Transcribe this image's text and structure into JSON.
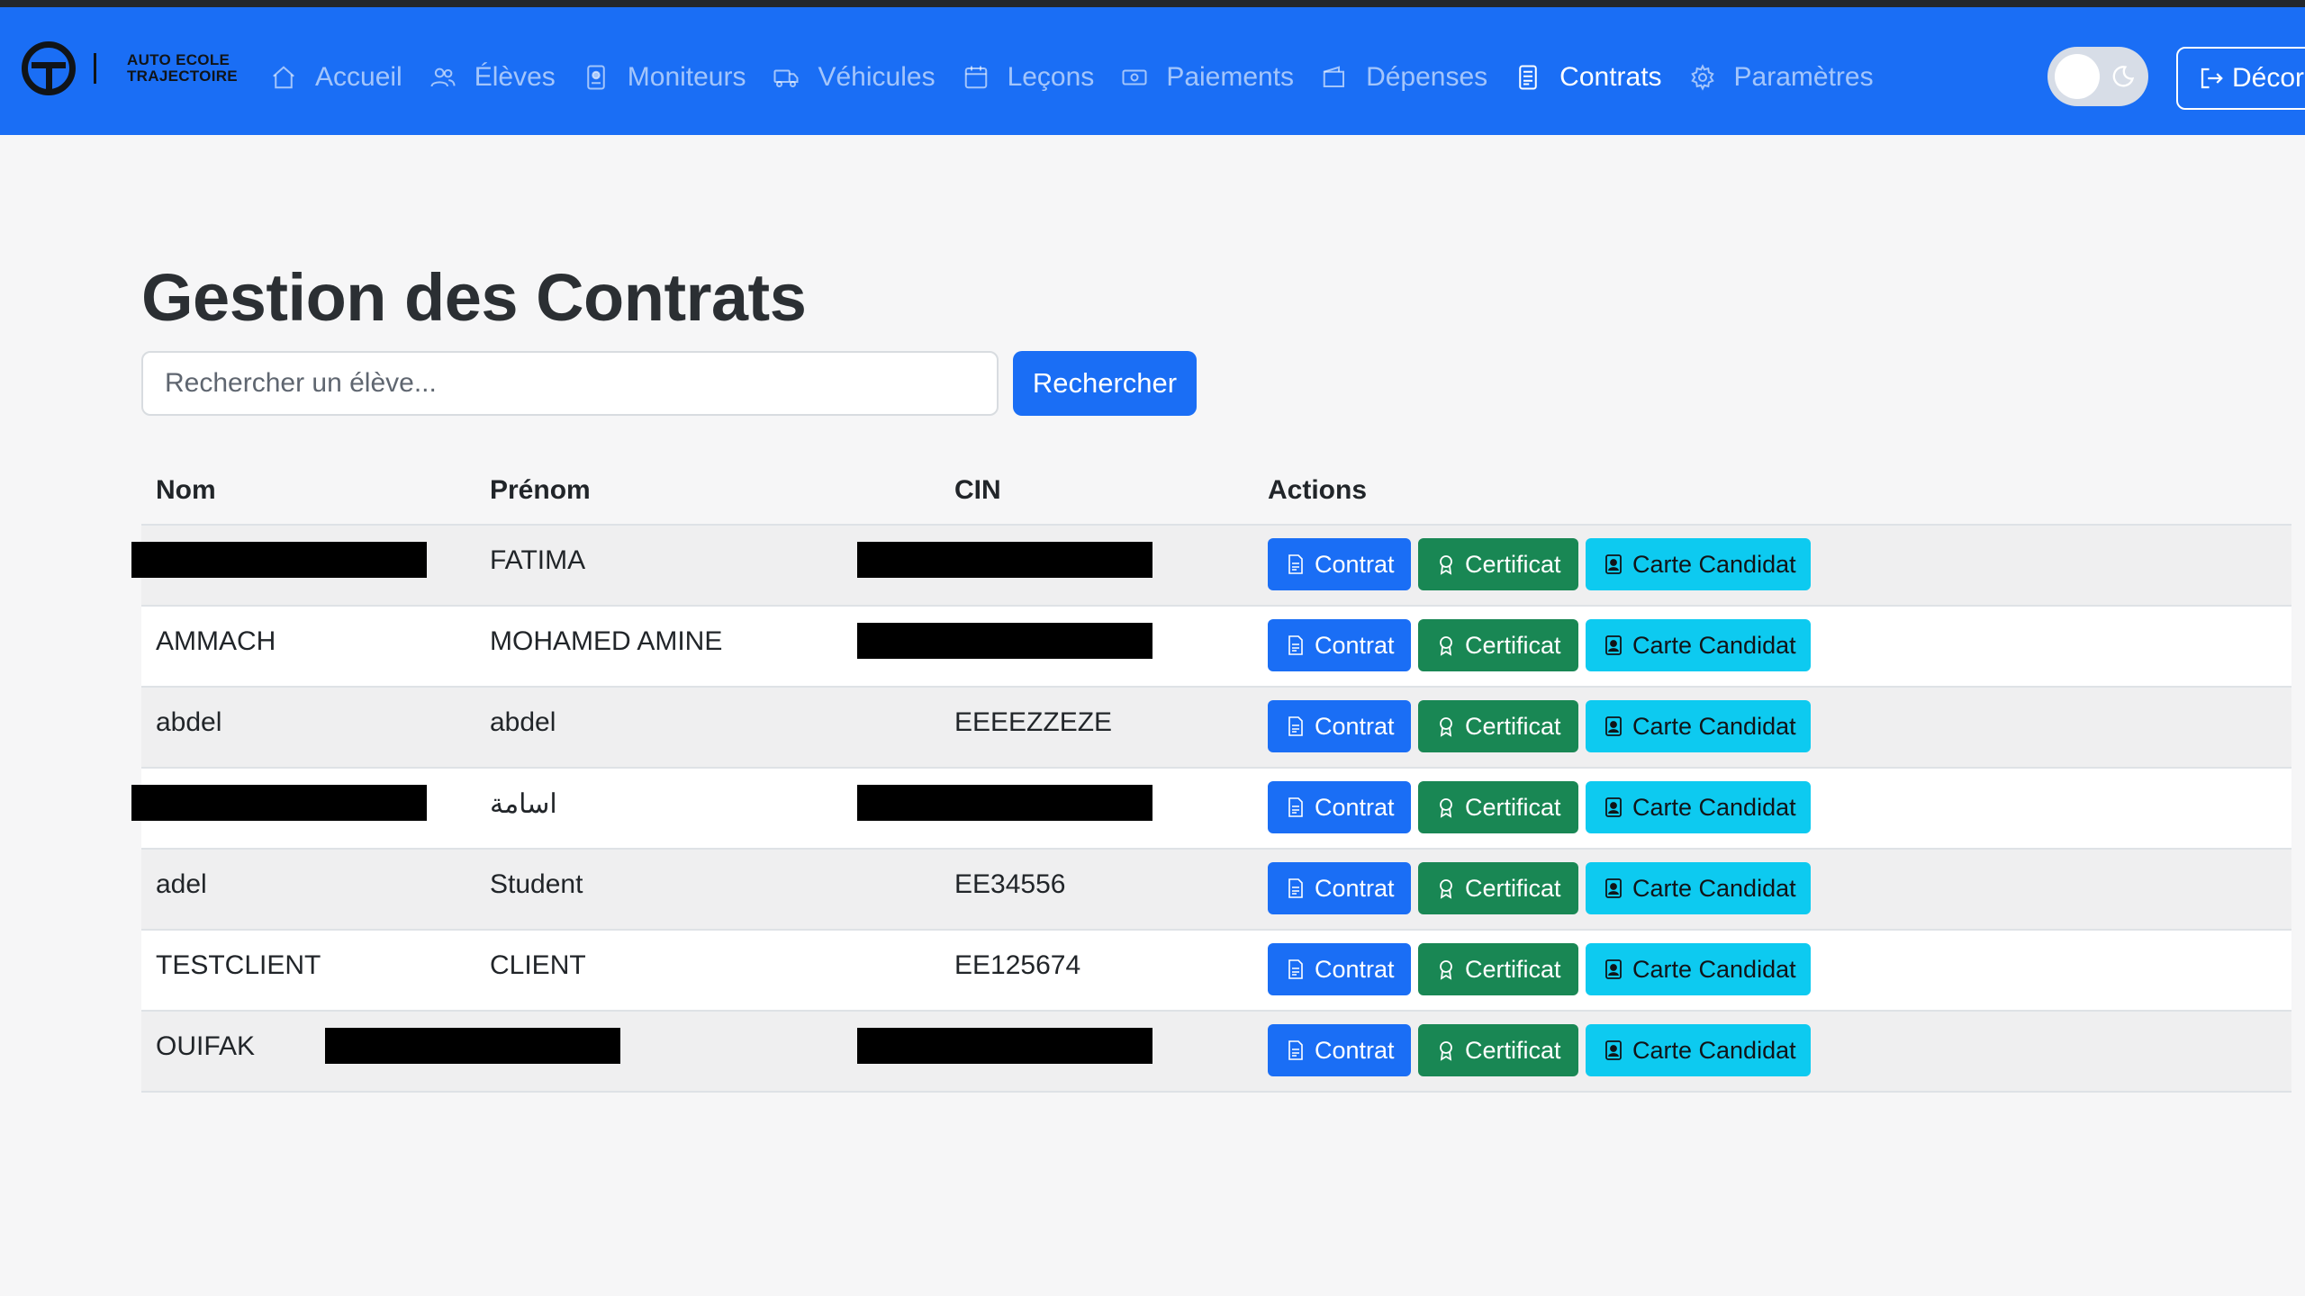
{
  "brand": {
    "line1": "AUTO ECOLE",
    "line2": "TRAJECTOIRE"
  },
  "nav": {
    "items": [
      {
        "label": "Accueil",
        "icon": "home-icon"
      },
      {
        "label": "Élèves",
        "icon": "users-icon"
      },
      {
        "label": "Moniteurs",
        "icon": "badge-icon"
      },
      {
        "label": "Véhicules",
        "icon": "truck-icon"
      },
      {
        "label": "Leçons",
        "icon": "calendar-icon"
      },
      {
        "label": "Paiements",
        "icon": "cash-icon"
      },
      {
        "label": "Dépenses",
        "icon": "wallet-icon"
      },
      {
        "label": "Contrats",
        "icon": "document-icon",
        "active": true
      },
      {
        "label": "Paramètres",
        "icon": "gear-icon"
      }
    ],
    "logout_label": "Décor"
  },
  "page": {
    "title": "Gestion des Contrats",
    "search_placeholder": "Rechercher un élève...",
    "search_button": "Rechercher"
  },
  "table": {
    "headers": {
      "nom": "Nom",
      "prenom": "Prénom",
      "cin": "CIN",
      "actions": "Actions"
    },
    "action_labels": {
      "contrat": "Contrat",
      "certificat": "Certificat",
      "carte": "Carte Candidat"
    },
    "rows": [
      {
        "nom": "",
        "nom_redacted": true,
        "prenom": "FATIMA",
        "prenom_redacted": false,
        "cin": "",
        "cin_redacted": true
      },
      {
        "nom": "AMMACH",
        "nom_redacted": false,
        "prenom": "MOHAMED AMINE",
        "prenom_redacted": false,
        "cin": "",
        "cin_redacted": true
      },
      {
        "nom": "abdel",
        "nom_redacted": false,
        "prenom": "abdel",
        "prenom_redacted": false,
        "cin": "EEEEZZEZE",
        "cin_redacted": false
      },
      {
        "nom": "",
        "nom_redacted": true,
        "prenom": "اسامة",
        "prenom_redacted": false,
        "cin": "",
        "cin_redacted": true
      },
      {
        "nom": "adel",
        "nom_redacted": false,
        "prenom": "Student",
        "prenom_redacted": false,
        "cin": "EE34556",
        "cin_redacted": false
      },
      {
        "nom": "TESTCLIENT",
        "nom_redacted": false,
        "prenom": "CLIENT",
        "prenom_redacted": false,
        "cin": "EE125674",
        "cin_redacted": false
      },
      {
        "nom": "OUIFAK",
        "nom_redacted": false,
        "prenom": "",
        "prenom_redacted": true,
        "cin": "",
        "cin_redacted": true
      }
    ]
  },
  "colors": {
    "navbar": "#1a6ef5",
    "primary": "#1a6ef5",
    "success": "#198754",
    "info": "#0dcaf0"
  }
}
